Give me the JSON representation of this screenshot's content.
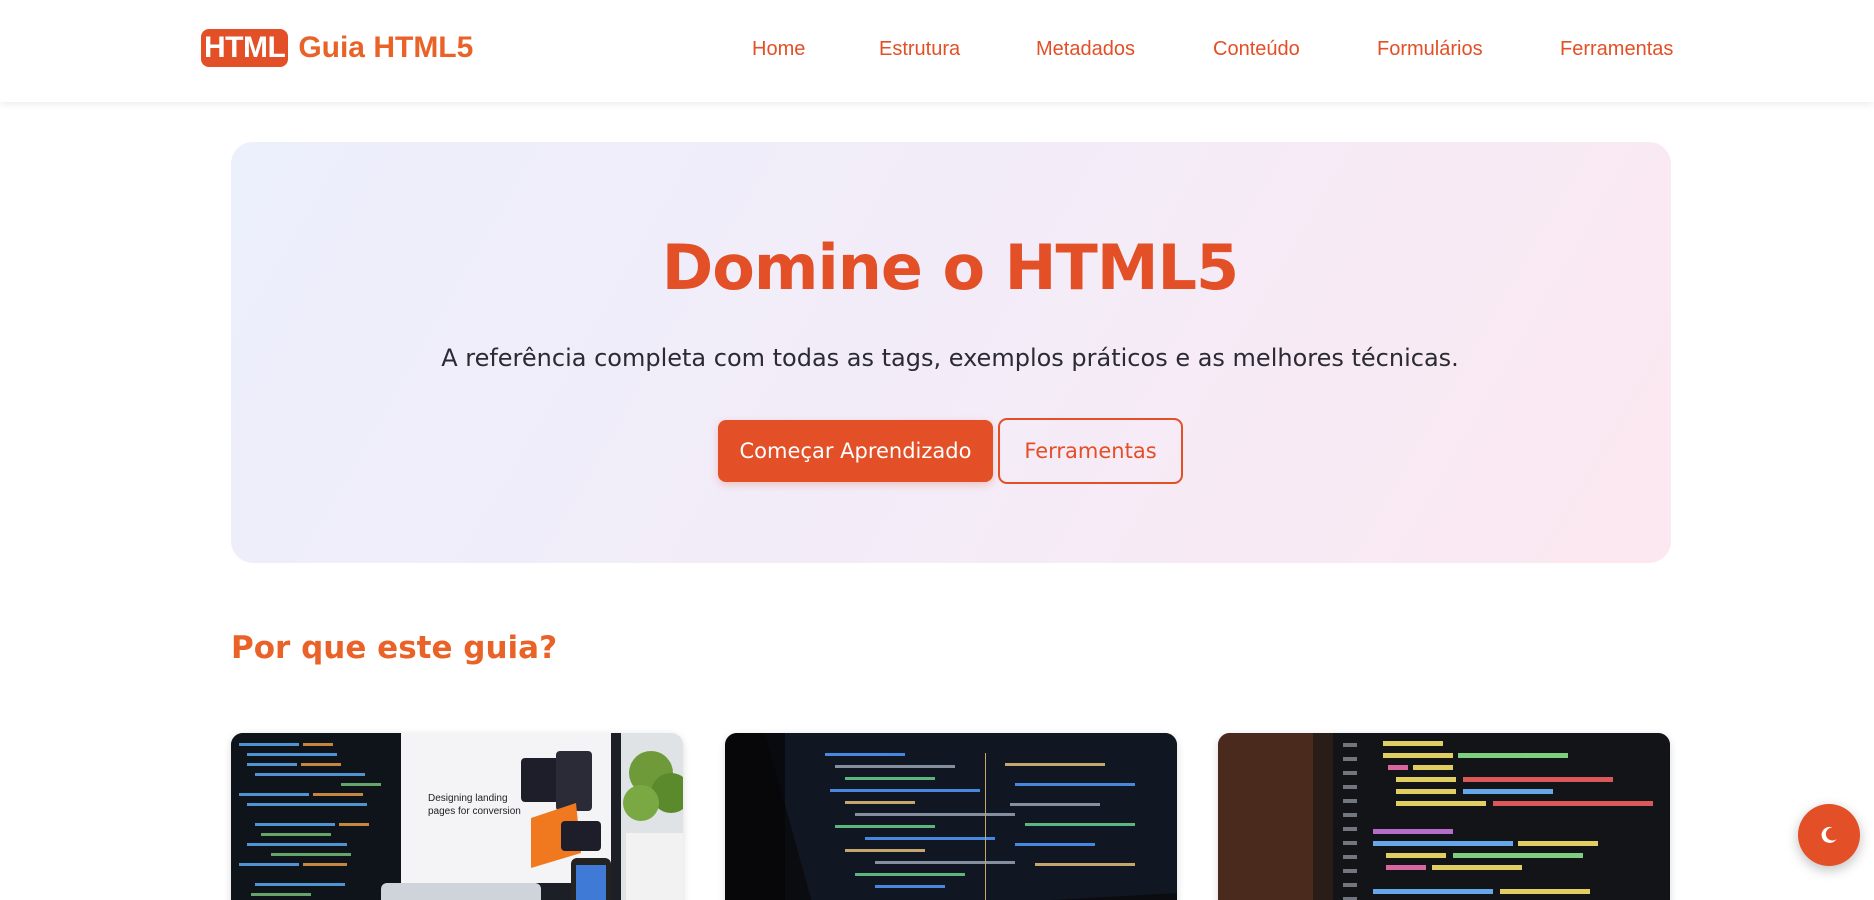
{
  "header": {
    "logo_badge": "HTML",
    "logo_text": "Guia HTML5",
    "nav": [
      "Home",
      "Estrutura",
      "Metadados",
      "Conteúdo",
      "Formulários",
      "Ferramentas"
    ]
  },
  "hero": {
    "title": "Domine o HTML5",
    "subtitle": "A referência completa com todas as tags, exemplos práticos e as melhores técnicas.",
    "primary_button": "Começar Aprendizado",
    "secondary_button": "Ferramentas"
  },
  "section": {
    "title": "Por que este guia?"
  },
  "cards": [
    {
      "image_text_line1": "Designing landing",
      "image_text_line2": "pages for conversion"
    },
    {},
    {}
  ],
  "theme_toggle": {
    "icon": "moon-icon"
  },
  "colors": {
    "accent": "#e34f26",
    "accent_light": "#e96228",
    "text": "#2b2b33"
  }
}
